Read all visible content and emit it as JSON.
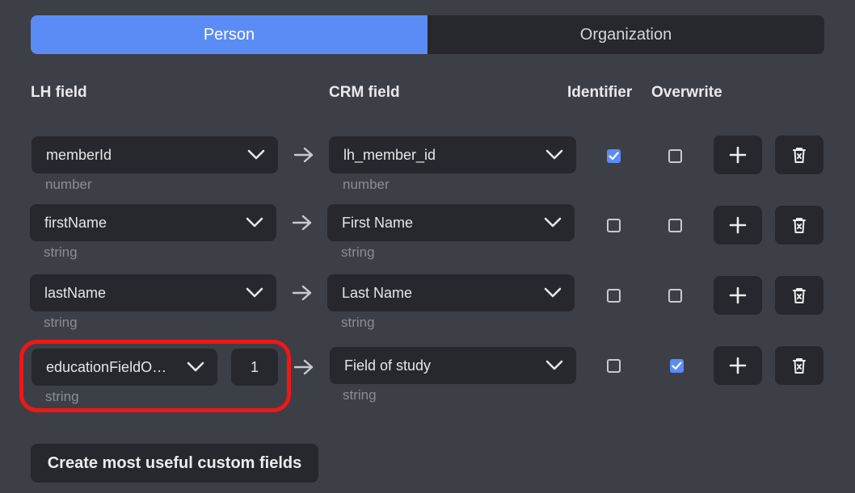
{
  "tabs": [
    {
      "label": "Person",
      "active": true
    },
    {
      "label": "Organization",
      "active": false
    }
  ],
  "headers": {
    "lh_field": "LH field",
    "crm_field": "CRM field",
    "identifier": "Identifier",
    "overwrite": "Overwrite"
  },
  "rows": [
    {
      "lh_field": "memberId",
      "lh_type": "number",
      "crm_field": "lh_member_id",
      "crm_type": "number",
      "identifier": true,
      "overwrite": false
    },
    {
      "lh_field": "firstName",
      "lh_type": "string",
      "crm_field": "First Name",
      "crm_type": "string",
      "identifier": false,
      "overwrite": false
    },
    {
      "lh_field": "lastName",
      "lh_type": "string",
      "crm_field": "Last Name",
      "crm_type": "string",
      "identifier": false,
      "overwrite": false
    },
    {
      "lh_field": "educationFieldO…",
      "index": "1",
      "lh_type": "string",
      "crm_field": "Field of study",
      "crm_type": "string",
      "identifier": false,
      "overwrite": true
    }
  ],
  "create_button": "Create most useful custom fields",
  "colors": {
    "background": "#3d3f46",
    "surface": "#27282d",
    "accent": "#5b8cf5",
    "highlight": "#f21616",
    "muted_text": "#8b8d95"
  },
  "icons": {
    "select": "chevron-down-icon",
    "mapping": "arrow-right-icon",
    "add": "plus-icon",
    "delete": "trash-icon",
    "checked": "check-icon"
  }
}
